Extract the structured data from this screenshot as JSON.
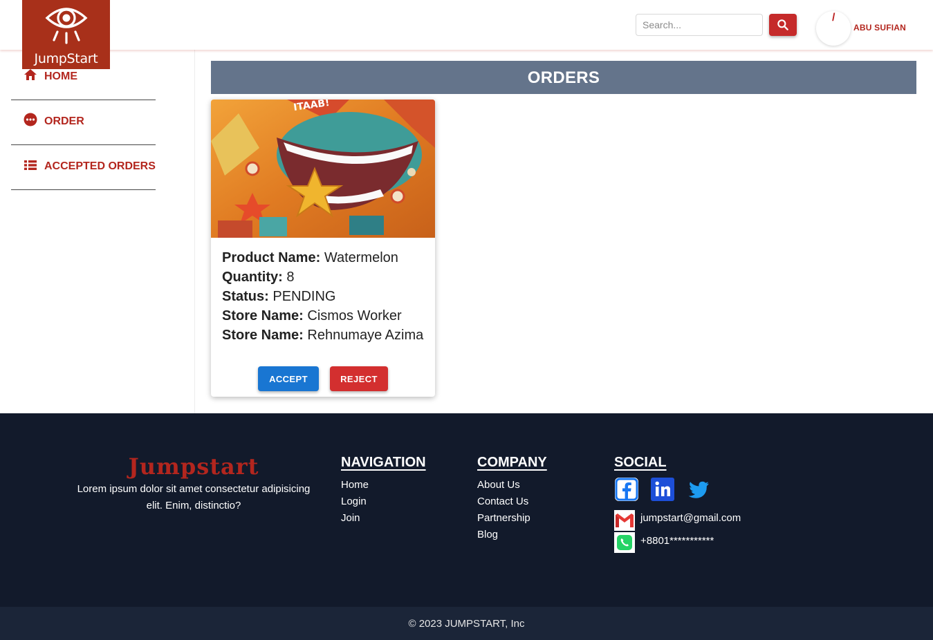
{
  "header": {
    "logo_text": "JumpStart",
    "search_placeholder": "Search...",
    "avatar_mark": "/",
    "user_name": "ABU SUFIAN"
  },
  "sidebar": {
    "items": [
      {
        "label": "HOME",
        "icon": "home-icon"
      },
      {
        "label": "ORDER",
        "icon": "more-icon"
      },
      {
        "label": "ACCEPTED ORDERS",
        "icon": "list-icon"
      }
    ]
  },
  "main": {
    "title": "ORDERS",
    "order": {
      "product_label": "Product Name:",
      "product_value": "Watermelon",
      "quantity_label": "Quantity:",
      "quantity_value": "8",
      "status_label": "Status:",
      "status_value": "PENDING",
      "store1_label": "Store Name:",
      "store1_value": "Cismos Worker",
      "store2_label": "Store Name:",
      "store2_value": "Rehnumaye Azima",
      "accept_label": "ACCEPT",
      "reject_label": "REJECT"
    }
  },
  "footer": {
    "brand": "Jumpstart",
    "description": "Lorem ipsum dolor sit amet consectetur adipisicing elit. Enim, distinctio?",
    "navigation": {
      "title": "NAVIGATION",
      "links": [
        "Home",
        "Login",
        "Join"
      ]
    },
    "company": {
      "title": "COMPANY",
      "links": [
        "About Us",
        "Contact Us",
        "Partnership",
        "Blog"
      ]
    },
    "social": {
      "title": "SOCIAL",
      "icons": [
        "facebook-icon",
        "linkedin-icon",
        "twitter-icon"
      ],
      "email": "jumpstart@gmail.com",
      "phone": "+8801***********"
    },
    "copyright": "© 2023 JUMPSTART, Inc"
  },
  "colors": {
    "accent_red": "#b3261e",
    "logo_bg": "#a8301a",
    "orders_bar": "#64748b",
    "accept_blue": "#1976d2",
    "reject_red": "#d32f2f",
    "footer_bg": "#121a2b"
  }
}
